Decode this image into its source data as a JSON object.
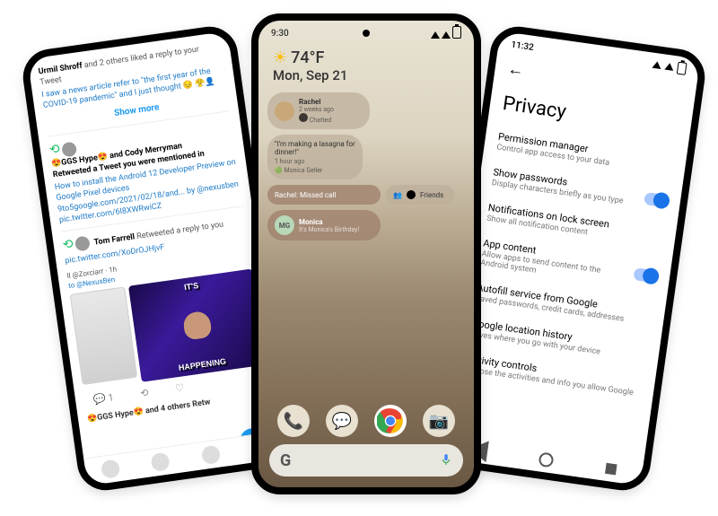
{
  "left": {
    "notif": {
      "name": "Urmil Shroff",
      "suffix": " and 2 others liked a reply to your Tweet",
      "body": "I saw a news article refer to \"the first year of the COVID-19 pandemic\" and I just thought 😔 😤👤"
    },
    "showmore": "Show more",
    "rt1": {
      "who": "😍GGS Hype😍 and Cody Merryman",
      "act": "Retweeted a Tweet you were mentioned in",
      "body": "How to install the Android 12 Developer Preview on Google Pixel devices 9to5google.com/2021/02/18/and... by @nexusben pic.twitter.com/6I8XWRwiCZ"
    },
    "rt2": {
      "who": "Tom Farrell",
      "act": " Retweeted a reply to you",
      "body": "pic.twitter.com/XoDrOJHjvF"
    },
    "qt": {
      "handle": "ll @Zorciarr · 1h",
      "to": "to @NexusBen"
    },
    "meme": {
      "top": "IT'S",
      "bot": "HAPPENING"
    },
    "foot": "😍GGS Hype😍 and 4 others Retw"
  },
  "center": {
    "time": "9:30",
    "temp": "74°F",
    "date": "Mon, Sep 21",
    "c1": {
      "name": "Rachel",
      "sub": "2 weeks ago",
      "sub2": "Chatted"
    },
    "c2": {
      "quote": "\"I'm making a lasagna for dinner!\"",
      "time": "1 hour ago",
      "name": "Monica Geller"
    },
    "c3": "Rachel: Missed call",
    "c4": "Friends",
    "c5": {
      "init": "MG",
      "name": "Monica",
      "sub": "It's Monica's Birthday!"
    },
    "search": "G"
  },
  "right": {
    "time": "11:32",
    "title": "Privacy",
    "rows": [
      {
        "l": "Permission manager",
        "s": "Control app access to your data",
        "t": false
      },
      {
        "l": "Show passwords",
        "s": "Display characters briefly as you type",
        "t": true
      },
      {
        "l": "Notifications on lock screen",
        "s": "Show all notification content",
        "t": false
      },
      {
        "l": "App content",
        "s": "Allow apps to send content to the Android system",
        "t": true
      },
      {
        "l": "Autofill service from Google",
        "s": "Saved passwords, credit cards, addresses",
        "t": false
      },
      {
        "l": "Google location history",
        "s": "Saves where you go with your device",
        "t": false
      },
      {
        "l": "Activity controls",
        "s": "Choose the activities and info you allow Google",
        "t": false
      }
    ]
  }
}
